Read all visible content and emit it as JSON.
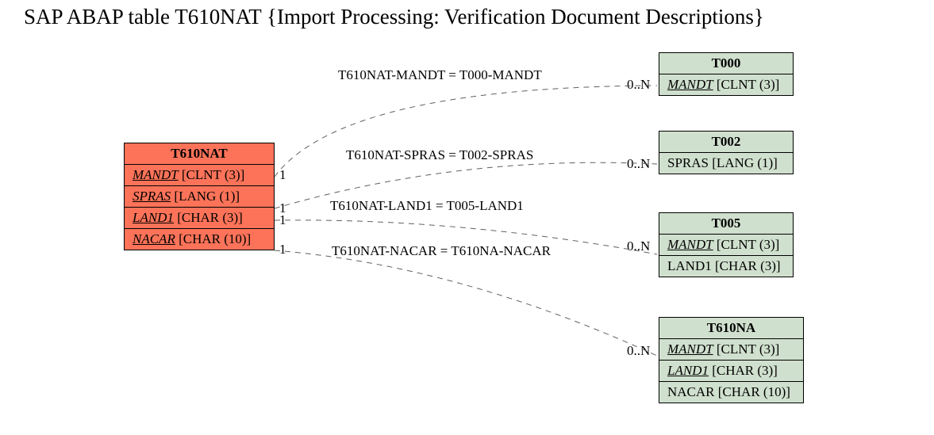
{
  "title": "SAP ABAP table T610NAT {Import Processing: Verification Document Descriptions}",
  "main_table": {
    "name": "T610NAT",
    "fields": [
      {
        "key": "MANDT",
        "type": "[CLNT (3)]"
      },
      {
        "key": "SPRAS",
        "type": "[LANG (1)]"
      },
      {
        "key": "LAND1",
        "type": "[CHAR (3)]"
      },
      {
        "key": "NACAR",
        "type": "[CHAR (10)]"
      }
    ]
  },
  "ref_tables": [
    {
      "name": "T000",
      "fields": [
        {
          "key": "MANDT",
          "type": "[CLNT (3)]",
          "is_key": true
        }
      ]
    },
    {
      "name": "T002",
      "fields": [
        {
          "key": "SPRAS",
          "type": "[LANG (1)]",
          "is_key": false
        }
      ]
    },
    {
      "name": "T005",
      "fields": [
        {
          "key": "MANDT",
          "type": "[CLNT (3)]",
          "is_key": true
        },
        {
          "key": "LAND1",
          "type": "[CHAR (3)]",
          "is_key": false
        }
      ]
    },
    {
      "name": "T610NA",
      "fields": [
        {
          "key": "MANDT",
          "type": "[CLNT (3)]",
          "is_key": true
        },
        {
          "key": "LAND1",
          "type": "[CHAR (3)]",
          "is_key": true
        },
        {
          "key": "NACAR",
          "type": "[CHAR (10)]",
          "is_key": false
        }
      ]
    }
  ],
  "relations": [
    {
      "label": "T610NAT-MANDT = T000-MANDT",
      "left_card": "1",
      "right_card": "0..N"
    },
    {
      "label": "T610NAT-SPRAS = T002-SPRAS",
      "left_card": "1",
      "right_card": "0..N"
    },
    {
      "label": "T610NAT-LAND1 = T005-LAND1",
      "left_card": "1",
      "right_card": "0..N"
    },
    {
      "label": "T610NAT-NACAR = T610NA-NACAR",
      "left_card": "1",
      "right_card": "0..N"
    }
  ]
}
